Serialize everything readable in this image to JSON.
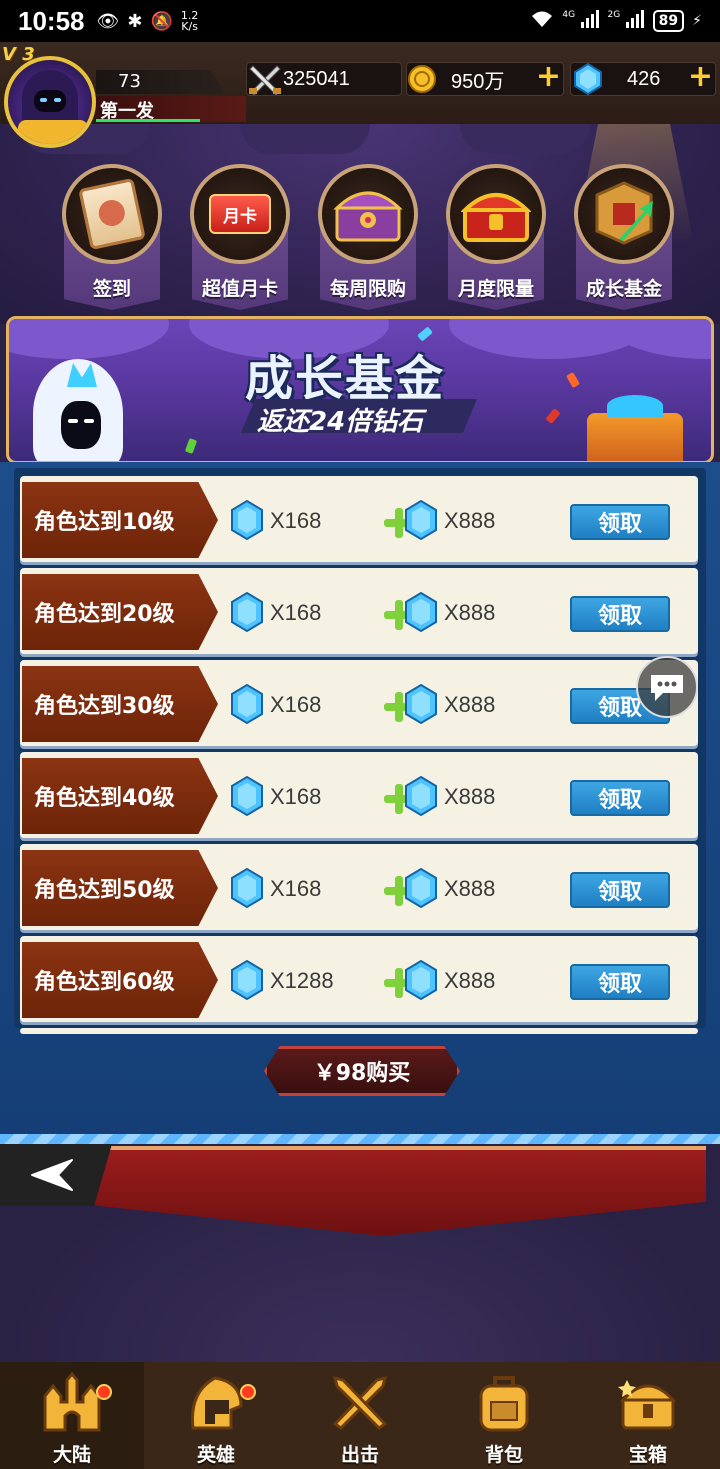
{
  "status_bar": {
    "time": "10:58",
    "speed_value": "1.2",
    "speed_unit": "K/s",
    "network_1": "4G",
    "network_2": "2G",
    "battery": "89"
  },
  "player": {
    "vip_label": "V 3",
    "level": "73",
    "name": "第一发"
  },
  "resources": {
    "power": "325041",
    "gold": "950万",
    "diamond": "426",
    "plus": "+"
  },
  "shop": {
    "items": [
      {
        "label": "签到",
        "icon": "scroll-icon"
      },
      {
        "label": "超值月卡",
        "icon": "month-card-icon",
        "card_text": "月卡"
      },
      {
        "label": "每周限购",
        "icon": "purple-chest-icon"
      },
      {
        "label": "月度限量",
        "icon": "gold-chest-icon"
      },
      {
        "label": "成长基金",
        "icon": "growth-fund-icon"
      }
    ]
  },
  "promo": {
    "title": "成长基金",
    "subtitle": "返还24倍钻石"
  },
  "rewards": [
    {
      "label": "角色达到10级",
      "reward1": "X168",
      "reward2": "X888",
      "button": "领取"
    },
    {
      "label": "角色达到20级",
      "reward1": "X168",
      "reward2": "X888",
      "button": "领取"
    },
    {
      "label": "角色达到30级",
      "reward1": "X168",
      "reward2": "X888",
      "button": "领取"
    },
    {
      "label": "角色达到40级",
      "reward1": "X168",
      "reward2": "X888",
      "button": "领取"
    },
    {
      "label": "角色达到50级",
      "reward1": "X168",
      "reward2": "X888",
      "button": "领取"
    },
    {
      "label": "角色达到60级",
      "reward1": "X1288",
      "reward2": "X888",
      "button": "领取"
    }
  ],
  "buy_button": "￥98购买",
  "nav": [
    {
      "label": "大陆",
      "icon": "castle-icon",
      "has_dot": true
    },
    {
      "label": "英雄",
      "icon": "helmet-icon",
      "has_dot": true
    },
    {
      "label": "出击",
      "icon": "crossed-swords-icon",
      "has_dot": false
    },
    {
      "label": "背包",
      "icon": "backpack-icon",
      "has_dot": false
    },
    {
      "label": "宝箱",
      "icon": "treasure-chest-icon",
      "has_dot": false
    }
  ],
  "colors": {
    "claim_button": "#2b8fd3",
    "ribbon": "#7a2b0c",
    "gem": "#4fc3ff",
    "gold_accent": "#ffce2e"
  }
}
